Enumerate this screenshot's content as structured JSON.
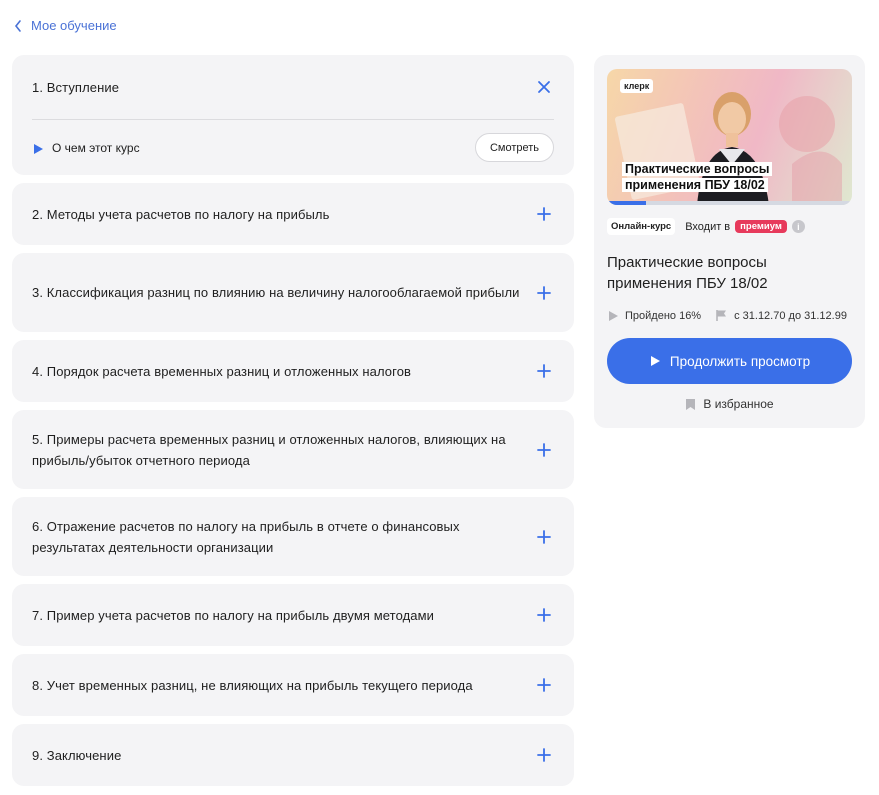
{
  "nav": {
    "back_label": "Мое обучение"
  },
  "modules": [
    {
      "title": "1. Вступление",
      "lessons": [
        {
          "title": "О чем этот курс",
          "action": "Смотреть"
        }
      ]
    },
    {
      "title": "2. Методы учета расчетов по налогу на прибыль"
    },
    {
      "title": "3. Классификация разниц по влиянию на величину налогооблагаемой прибыли"
    },
    {
      "title": "4. Порядок расчета временных разниц и отложенных налогов"
    },
    {
      "title": "5. Примеры расчета временных разниц и отложенных налогов, влияющих на прибыль/убыток отчетного периода"
    },
    {
      "title": "6. Отражение расчетов по налогу на прибыль в отчете о финансовых результатах деятельности организации"
    },
    {
      "title": "7. Пример учета расчетов по налогу на прибыль двумя методами"
    },
    {
      "title": "8. Учет временных разниц, не влияющих на прибыль текущего периода"
    },
    {
      "title": "9. Заключение"
    }
  ],
  "course_card": {
    "logo": "клерк",
    "thumb_title_line1": "Практические вопросы",
    "thumb_title_line2": "применения ПБУ 18/02",
    "progress_fraction": 0.16,
    "badge_online": "Онлайн-курс",
    "badge_included": "Входит в",
    "badge_premium": "премиум",
    "info_glyph": "i",
    "title": "Практические вопросы применения ПБУ 18/02",
    "progress_label": "Пройдено 16%",
    "dates_label": "с  31.12.70 до 31.12.99",
    "continue_label": "Продолжить просмотр",
    "favorite_label": "В избранное"
  },
  "colors": {
    "accent": "#3a6fe8",
    "premium": "#e73a5c",
    "card_bg": "#f4f4f6",
    "link": "#4a72d6"
  }
}
